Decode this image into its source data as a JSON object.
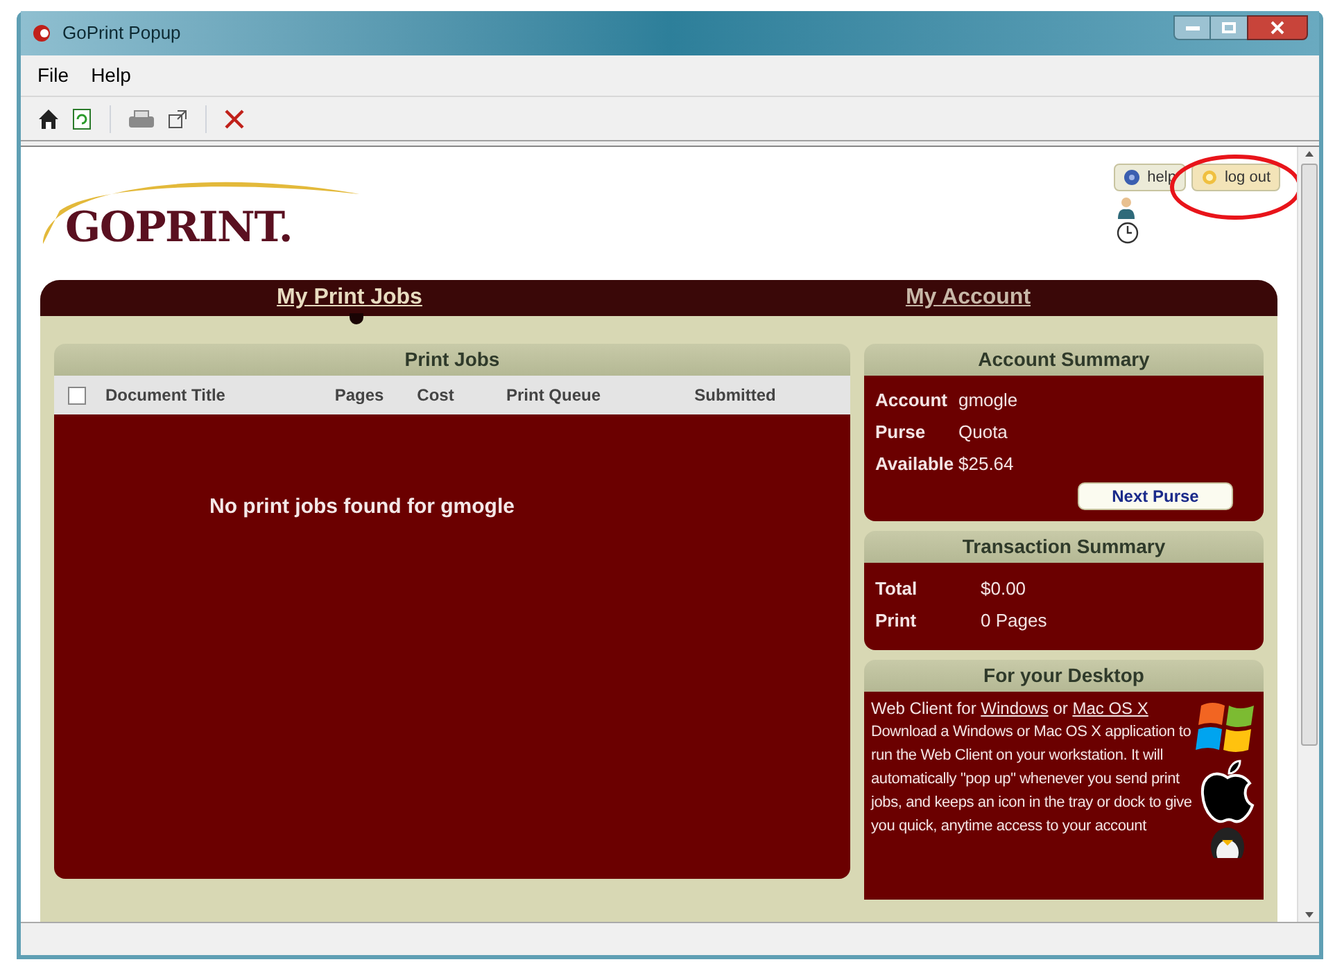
{
  "window": {
    "title": "GoPrint Popup"
  },
  "menu": [
    "File",
    "Help"
  ],
  "toolbar": [
    {
      "kind": "home"
    },
    {
      "kind": "refresh"
    },
    {
      "kind": "separator"
    },
    {
      "kind": "printer"
    },
    {
      "kind": "external"
    },
    {
      "kind": "separator"
    },
    {
      "kind": "close"
    }
  ],
  "logo": {
    "text": "GOPRINT."
  },
  "header_buttons": [
    {
      "label": "help",
      "kind": "help",
      "highlighted": false
    },
    {
      "label": "log out",
      "kind": "logout",
      "highlighted": true
    }
  ],
  "tabs": [
    {
      "label": "My Print Jobs",
      "selected": true
    },
    {
      "label": "My Account",
      "selected": false
    }
  ],
  "print_jobs": {
    "title": "Print Jobs",
    "select_all": {
      "checked": false
    },
    "columns": [
      "Document Title",
      "Pages",
      "Cost",
      "Print Queue",
      "Submitted"
    ],
    "empty_message": "No print jobs found for gmogle"
  },
  "account_summary": {
    "title": "Account Summary",
    "rows": [
      {
        "label": "Account",
        "value": "gmogle"
      },
      {
        "label": "Purse",
        "value": "Quota"
      },
      {
        "label": "Available",
        "value": "$25.64"
      }
    ],
    "button": "Next Purse"
  },
  "transaction_summary": {
    "title": "Transaction Summary",
    "rows": [
      {
        "label": "Total",
        "value": "$0.00"
      },
      {
        "label": "Print",
        "value": "0 Pages"
      }
    ]
  },
  "desktop": {
    "title": "For your Desktop",
    "intro": "Web Client for",
    "link_1": "Windows",
    "joiner": "or",
    "link_2": "Mac OS X",
    "text": "Download a Windows or Mac OS X application to run the Web Client on your workstation. It will automatically \"pop up\" whenever you send print jobs, and keeps an icon in the tray or dock to give you quick, anytime access to your account"
  }
}
